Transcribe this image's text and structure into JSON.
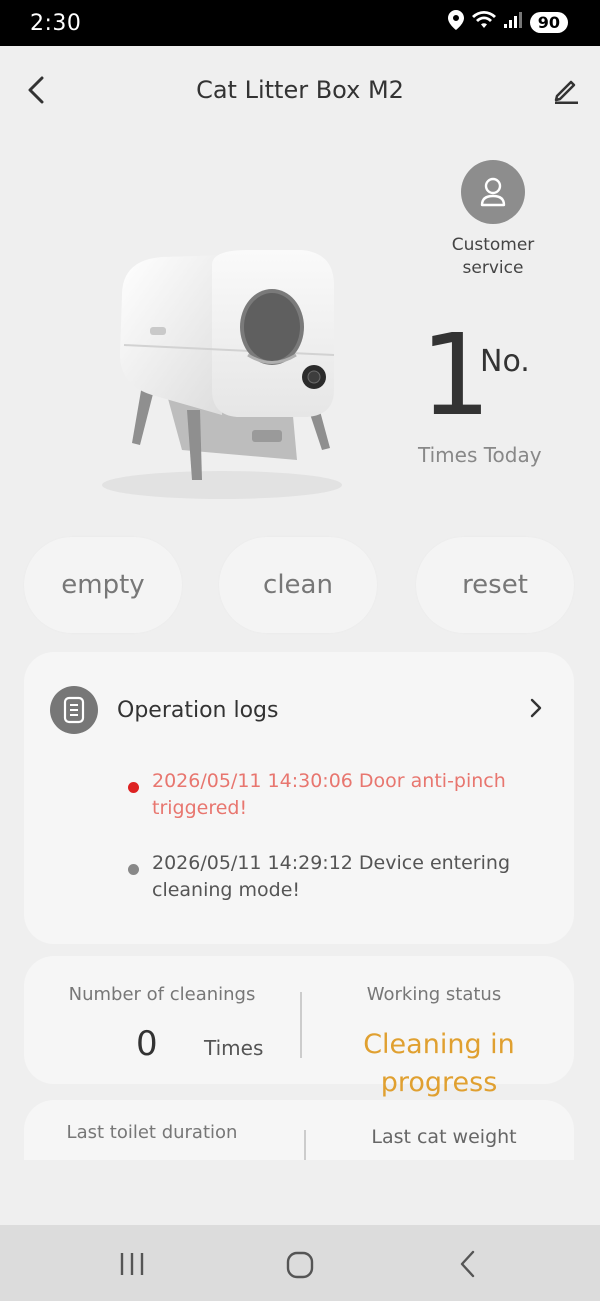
{
  "status_bar": {
    "time": "2:30",
    "battery": "90"
  },
  "header": {
    "title": "Cat Litter Box M2"
  },
  "customer_service": {
    "label": "Customer service"
  },
  "today": {
    "count": "1",
    "unit": "No.",
    "label": "Times Today"
  },
  "actions": {
    "empty": "empty",
    "clean": "clean",
    "reset": "reset"
  },
  "logs": {
    "title": "Operation logs",
    "items": [
      {
        "text": "2026/05/11 14:30:06 Door anti-pinch triggered!",
        "color": "#e8766f",
        "dot": "#dd2222"
      },
      {
        "text": "2026/05/11 14:29:12 Device entering cleaning mode!",
        "color": "#555555",
        "dot": "#888888"
      }
    ]
  },
  "stats": {
    "cleanings_label": "Number of cleanings",
    "cleanings_value": "0",
    "cleanings_unit": "Times",
    "working_label": "Working status",
    "working_value": "Cleaning in progress",
    "working_color": "#e0a030",
    "toilet_duration_label": "Last toilet duration",
    "cat_weight_label": "Last cat weight"
  },
  "icons": {
    "back": "back-chevron-icon",
    "edit": "pencil-icon",
    "customer_service": "user-icon",
    "logs": "document-icon"
  }
}
